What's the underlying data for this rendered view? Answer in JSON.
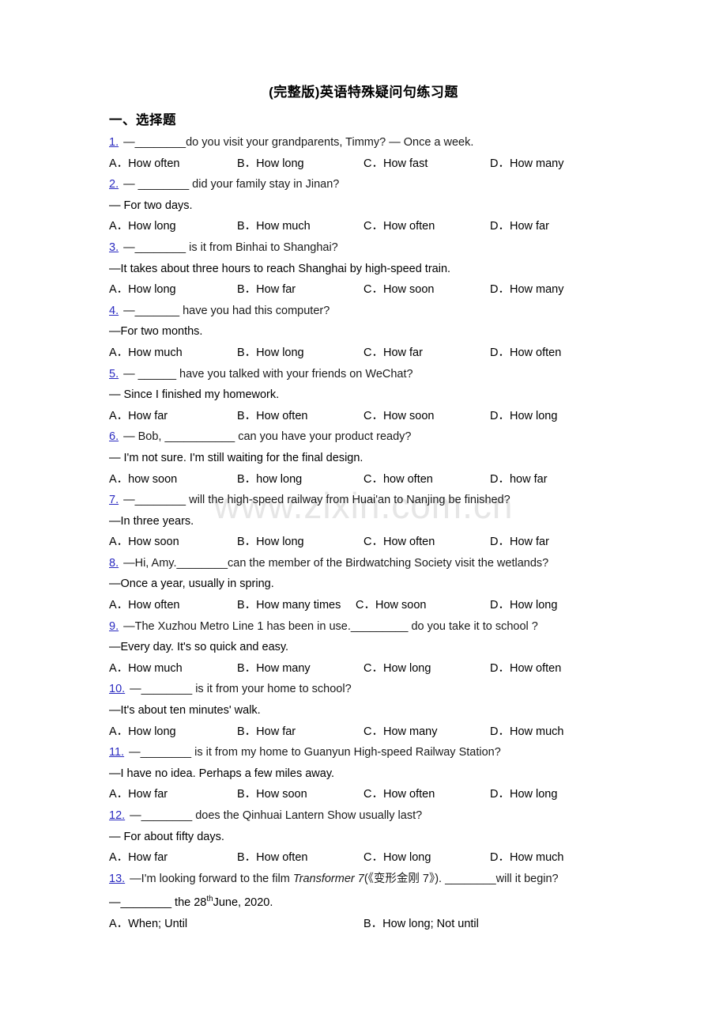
{
  "document": {
    "title": "(完整版)英语特殊疑问句练习题",
    "section_heading": "一、选择题",
    "watermark": "www.zixin.com.cn"
  },
  "questions": [
    {
      "num": "1.",
      "stem": "—________do you visit your grandparents, Timmy? —  Once a week.",
      "reply": null,
      "options": [
        "A．How often",
        "B．How long",
        "C．How fast",
        "D．How many"
      ]
    },
    {
      "num": "2.",
      "stem": "— ________ did your family stay in Jinan?",
      "reply": "— For two days.",
      "options": [
        "A．How long",
        "B．How much",
        "C．How often",
        "D．How far"
      ]
    },
    {
      "num": "3.",
      "stem": "—________ is it from Binhai to Shanghai?",
      "reply": "—It takes about three hours to reach Shanghai by high-speed train.",
      "options": [
        "A．How long",
        "B．How far",
        "C．How soon",
        "D．How many"
      ]
    },
    {
      "num": "4.",
      "stem": "—_______ have you had this computer?",
      "reply": "—For two months.",
      "options": [
        "A．How much",
        "B．How long",
        "C．How far",
        "D．How often"
      ]
    },
    {
      "num": "5.",
      "stem": "— ______ have you talked with your friends on WeChat?",
      "reply": "— Since I finished my homework.",
      "options": [
        "A．How far",
        "B．How often",
        "C．How soon",
        "D．How long"
      ]
    },
    {
      "num": "6.",
      "stem": "— Bob, ___________ can you have your product ready?",
      "reply": "— I'm not sure. I'm still waiting for the final design.",
      "options": [
        "A．how soon",
        "B．how long",
        "C．how often",
        "D．how far"
      ]
    },
    {
      "num": "7.",
      "stem": "—________ will the high-speed railway from Huai'an to Nanjing be finished?",
      "reply": "—In three years.",
      "options": [
        "A．How soon",
        "B．How long",
        "C．How often",
        "D．How far"
      ]
    },
    {
      "num": "8.",
      "stem": "—Hi, Amy.________can the member of the Birdwatching Society visit the wetlands?",
      "reply": "—Once a year, usually in spring.",
      "options": [
        "A．How often",
        "B．How many times",
        "C．How soon",
        "D．How long"
      ]
    },
    {
      "num": "9.",
      "stem": "—The Xuzhou Metro Line 1 has been in use._________ do you take it to school ?",
      "reply": "—Every day. It's so quick and easy.",
      "options": [
        "A．How much",
        "B．How many",
        "C．How long",
        "D．How often"
      ]
    },
    {
      "num": "10.",
      "stem": "—________ is it from your home to school?",
      "reply": "—It's about ten minutes' walk.",
      "options": [
        "A．How long",
        "B．How far",
        "C．How many",
        "D．How much"
      ]
    },
    {
      "num": "11.",
      "stem": "—________ is it from my home to Guanyun High-speed Railway Station?",
      "reply": "—I have no idea. Perhaps a few miles away.",
      "options": [
        "A．How far",
        "B．How soon",
        "C．How often",
        "D．How long"
      ]
    },
    {
      "num": "12.",
      "stem": "—________ does the Qinhuai Lantern Show usually last?",
      "reply": "— For about fifty days.",
      "options": [
        "A．How far",
        "B．How often",
        "C．How long",
        "D．How much"
      ]
    },
    {
      "num": "13.",
      "stem_parts": {
        "pre": "—I'm looking forward to the film ",
        "italic": "Transformer 7",
        "post": "(《变形金刚 7》). ________will it begin?"
      },
      "reply_parts": {
        "pre": "—________ the 28",
        "sup": "th",
        "post": "June, 2020."
      },
      "options": [
        "A．When; Until",
        "B．How long; Not until"
      ]
    }
  ]
}
